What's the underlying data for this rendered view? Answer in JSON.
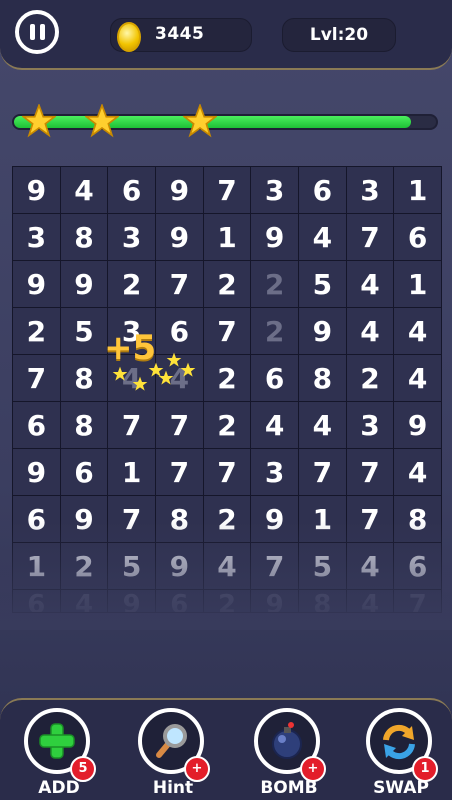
{
  "header": {
    "coins": "3445",
    "level": "Lvl:20"
  },
  "progress": {
    "fraction": 0.94,
    "stars_earned": 3
  },
  "board": {
    "rows": [
      [
        "9",
        "4",
        "6",
        "9",
        "7",
        "3",
        "6",
        "3",
        "1"
      ],
      [
        "3",
        "8",
        "3",
        "9",
        "1",
        "9",
        "4",
        "7",
        "6"
      ],
      [
        "9",
        "9",
        "2",
        "7",
        "2",
        "2",
        "5",
        "4",
        "1"
      ],
      [
        "2",
        "5",
        "3",
        "6",
        "7",
        "2",
        "9",
        "4",
        "4"
      ],
      [
        "7",
        "8",
        "4",
        "4",
        "2",
        "6",
        "8",
        "2",
        "4"
      ],
      [
        "6",
        "8",
        "7",
        "7",
        "2",
        "4",
        "4",
        "3",
        "9"
      ],
      [
        "9",
        "6",
        "1",
        "7",
        "7",
        "3",
        "7",
        "7",
        "4"
      ],
      [
        "6",
        "9",
        "7",
        "8",
        "2",
        "9",
        "1",
        "7",
        "8"
      ],
      [
        "1",
        "2",
        "5",
        "9",
        "4",
        "7",
        "5",
        "4",
        "6"
      ],
      [
        "6",
        "4",
        "9",
        "6",
        "2",
        "9",
        "8",
        "4",
        "7"
      ]
    ],
    "dimmed": [
      [
        2,
        5
      ],
      [
        3,
        5
      ],
      [
        4,
        2
      ],
      [
        4,
        3
      ]
    ]
  },
  "popup": {
    "text": "+5"
  },
  "tools": [
    {
      "label": "ADD",
      "badge": "5",
      "icon": "plus-icon"
    },
    {
      "label": "Hint",
      "badge": "+",
      "icon": "magnifier-icon"
    },
    {
      "label": "BOMB",
      "badge": "+",
      "icon": "bomb-icon"
    },
    {
      "label": "SWAP",
      "badge": "1",
      "icon": "swap-icon"
    }
  ],
  "colors": {
    "progress": "#2ed146",
    "badge": "#e31e2a",
    "popup": "#ffc53a"
  }
}
